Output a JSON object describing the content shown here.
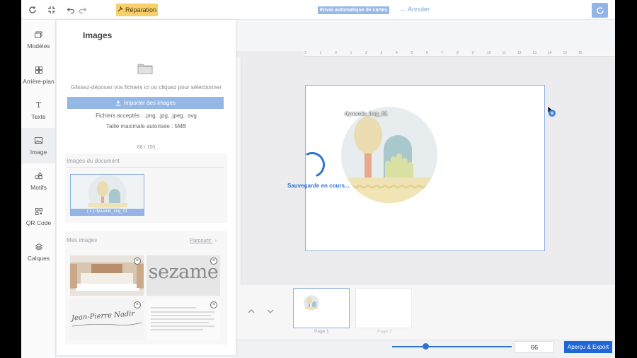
{
  "topbar": {
    "repair_label": "Réparation",
    "auto_send_label": "Envoi automatique de cartes",
    "cancel_label": "Annuler"
  },
  "rail": {
    "items": [
      {
        "label": "Modèles",
        "icon": "layout-icon"
      },
      {
        "label": "Arrière-plan",
        "icon": "grid-icon"
      },
      {
        "label": "Texte",
        "icon": "text-icon"
      },
      {
        "label": "Image",
        "icon": "image-icon"
      },
      {
        "label": "Motifs",
        "icon": "shapes-icon"
      },
      {
        "label": "QR Code",
        "icon": "qr-icon"
      },
      {
        "label": "Calques",
        "icon": "layers-icon"
      }
    ],
    "active": "Image"
  },
  "panel": {
    "title": "Images",
    "drop_text": "Glissez-déposez vos fichiers ici ou cliquez pour sélectionner",
    "import_label": "Importer des images",
    "accepted": "Fichiers acceptés : .png, .jpg, .jpeg, .svg",
    "max_size": "Taille maximale autorisée : 5MB",
    "count": "68 / 100",
    "doc_images_heading": "Images du document",
    "doc_image_caption": "{ x } dynamic_img_01",
    "my_images_heading": "Mes images",
    "browse_label": "Parcourir",
    "sezame_text": "sezame",
    "signature_text": "Jean-Pierre Nadir"
  },
  "canvas": {
    "ruler_ticks": [
      "2",
      "1",
      "0",
      "1",
      "2",
      "3",
      "4",
      "5",
      "6",
      "7",
      "8",
      "9",
      "10",
      "11",
      "12",
      "13",
      "14",
      "15",
      "16"
    ],
    "dynamic_label": "dynamic_img_01",
    "saving_text": "Sauvegarde en cours..."
  },
  "pages": {
    "page1": "Page 1",
    "page2": "Page 2"
  },
  "zoom": {
    "value": "66",
    "level": 0.28
  },
  "export_label": "Aperçu & Export",
  "colors": {
    "accent": "#1f66d8",
    "accent_light": "#95b7e6",
    "repair": "#f7cf6b"
  }
}
